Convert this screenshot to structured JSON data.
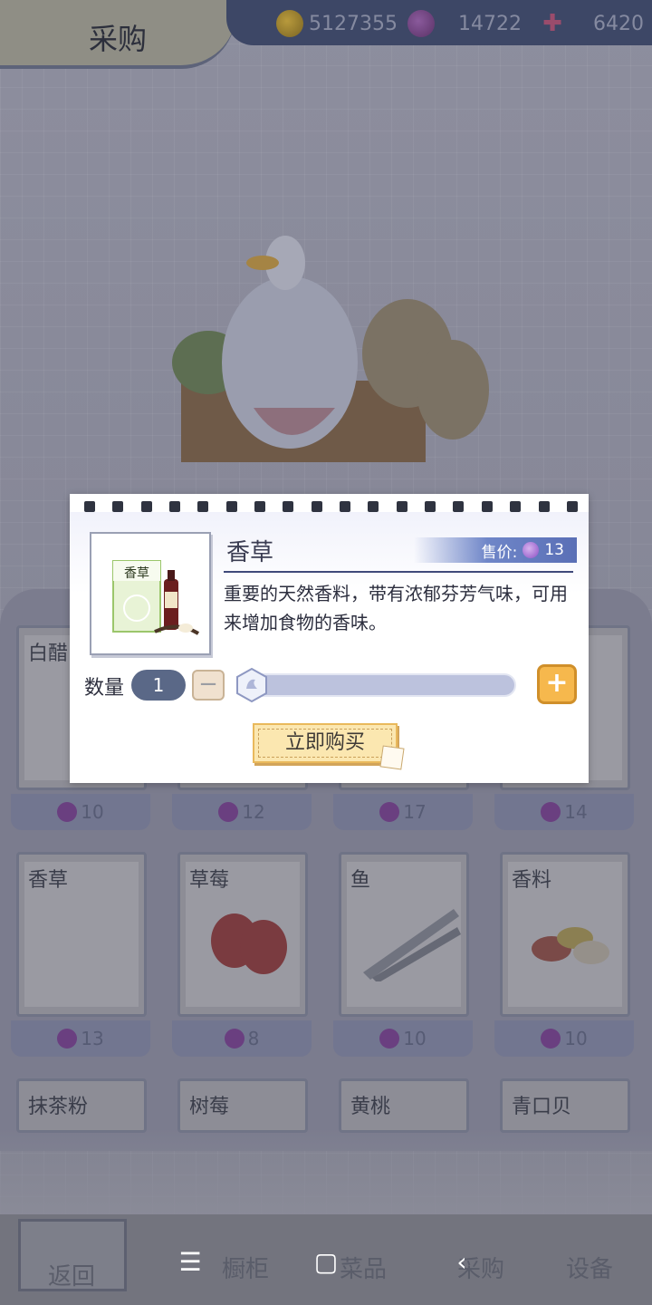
{
  "header": {
    "title": "采购",
    "currencies": [
      {
        "icon": "gold-coin-icon",
        "value": "5127355"
      },
      {
        "icon": "purple-gem-icon",
        "value": "14722"
      },
      {
        "icon": "wand-plus-icon",
        "value": "6420"
      }
    ]
  },
  "shop": {
    "items": [
      {
        "name": "白醋",
        "price": "10"
      },
      {
        "name": "",
        "price": "12"
      },
      {
        "name": "",
        "price": "17"
      },
      {
        "name": "",
        "price": "14"
      },
      {
        "name": "香草",
        "price": "13"
      },
      {
        "name": "草莓",
        "price": "8"
      },
      {
        "name": "鱼",
        "price": "10"
      },
      {
        "name": "香料",
        "price": "10"
      },
      {
        "name": "抹茶粉",
        "price": ""
      },
      {
        "name": "树莓",
        "price": ""
      },
      {
        "name": "黄桃",
        "price": ""
      },
      {
        "name": "青口贝",
        "price": ""
      }
    ]
  },
  "dialog": {
    "item_name": "香草",
    "box_label": "香草",
    "price_label": "售价:",
    "price_value": "13",
    "description": "重要的天然香料，带有浓郁芬芳气味，可用来增加食物的香味。",
    "quantity_label": "数量",
    "quantity_value": "1",
    "quantity_fraction": 0.0,
    "minus": "−",
    "plus": "+",
    "buy_label": "立即购买"
  },
  "nav": {
    "back": "返回",
    "items": [
      "橱柜",
      "菜品",
      "采购",
      "设备"
    ]
  },
  "system_nav": {
    "menu": "☰",
    "home": "▢",
    "back": "‹"
  },
  "colors": {
    "accent_blue": "#5a6fb6",
    "buy_button": "#fbe7b0",
    "plus_button": "#f6b84d",
    "pill": "#5a6887"
  }
}
